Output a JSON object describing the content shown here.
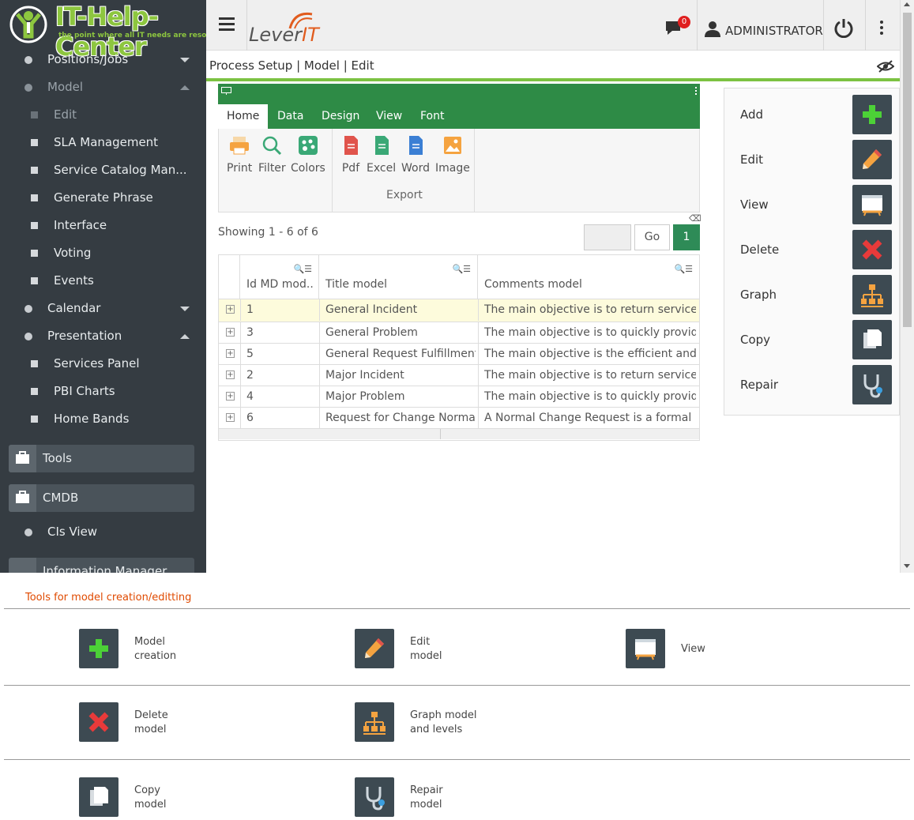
{
  "logo": {
    "title": "IT-Help-Center",
    "tagline": "the point where all IT needs are resolved"
  },
  "sidebar": {
    "items": [
      {
        "label": "Positions/Jobs"
      },
      {
        "label": "Model"
      },
      {
        "label": "Edit"
      },
      {
        "label": "SLA Management"
      },
      {
        "label": "Service Catalog Man..."
      },
      {
        "label": "Generate Phrase"
      },
      {
        "label": "Interface"
      },
      {
        "label": "Voting"
      },
      {
        "label": "Events"
      },
      {
        "label": "Calendar"
      },
      {
        "label": "Presentation"
      },
      {
        "label": "Services Panel"
      },
      {
        "label": "PBI Charts"
      },
      {
        "label": "Home Bands"
      }
    ],
    "groups": [
      {
        "label": "Tools"
      },
      {
        "label": "CMDB"
      },
      {
        "label": "Information Manager"
      }
    ],
    "cmdb_items": [
      {
        "label": "CIs View"
      }
    ]
  },
  "topbar": {
    "brand_main": "Lever",
    "brand_accent": "IT",
    "notifications": "0",
    "user": "ADMINISTRATOR"
  },
  "breadcrumb": "Process Setup | Model | Edit",
  "ribbon": {
    "tabs": [
      "Home",
      "Data",
      "Design",
      "View",
      "Font"
    ],
    "buttons": [
      "Print",
      "Filter",
      "Colors",
      "Pdf",
      "Excel",
      "Word",
      "Image"
    ],
    "export_label": "Export"
  },
  "pager": {
    "showing": "Showing 1 - 6 of 6",
    "go": "Go",
    "page": "1"
  },
  "grid": {
    "columns": [
      "Id MD mod...",
      "Title model",
      "Comments model"
    ],
    "rows": [
      {
        "id": "1",
        "title": "General Incident",
        "comment": "The main objective is to return service ..."
      },
      {
        "id": "3",
        "title": "General Problem",
        "comment": "The main objective is to quickly provid..."
      },
      {
        "id": "5",
        "title": "General Request Fulfillment",
        "comment": "The main objective is the efficient and ..."
      },
      {
        "id": "2",
        "title": "Major Incident",
        "comment": "The main objective is to return service ..."
      },
      {
        "id": "4",
        "title": "Major Problem",
        "comment": "The main objective is to quickly provid..."
      },
      {
        "id": "6",
        "title": "Request for Change Normal",
        "comment": "A Normal Change Request is a formal ..."
      }
    ]
  },
  "tools": [
    "Add",
    "Edit",
    "View",
    "Delete",
    "Graph",
    "Copy",
    "Repair"
  ],
  "doc": {
    "title": "Tools for model creation/editting",
    "items": [
      {
        "l1": "Model",
        "l2": "creation"
      },
      {
        "l1": "Edit",
        "l2": "model"
      },
      {
        "l1": "View",
        "l2": ""
      },
      {
        "l1": "Delete",
        "l2": "model"
      },
      {
        "l1": "Graph model",
        "l2": "and levels"
      },
      {
        "l1": "Copy",
        "l2": "model"
      },
      {
        "l1": "Repair",
        "l2": "model"
      }
    ]
  },
  "colors": {
    "sidebar": "#353c42",
    "accent_green": "#2e8b46",
    "line_green": "#7cc242",
    "doc_title": "#e04a00"
  }
}
